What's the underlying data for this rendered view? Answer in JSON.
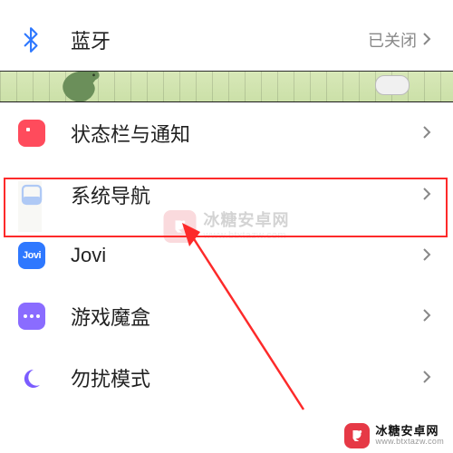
{
  "rows": {
    "bluetooth": {
      "label": "蓝牙",
      "value": "已关闭"
    },
    "status": {
      "label": "状态栏与通知"
    },
    "nav": {
      "label": "系统导航"
    },
    "jovi": {
      "label": "Jovi",
      "badge": "Jovi"
    },
    "game": {
      "label": "游戏魔盒"
    },
    "dnd": {
      "label": "勿扰模式"
    }
  },
  "watermark": {
    "name": "冰糖安卓网",
    "url": "www.btxtazw.com"
  }
}
